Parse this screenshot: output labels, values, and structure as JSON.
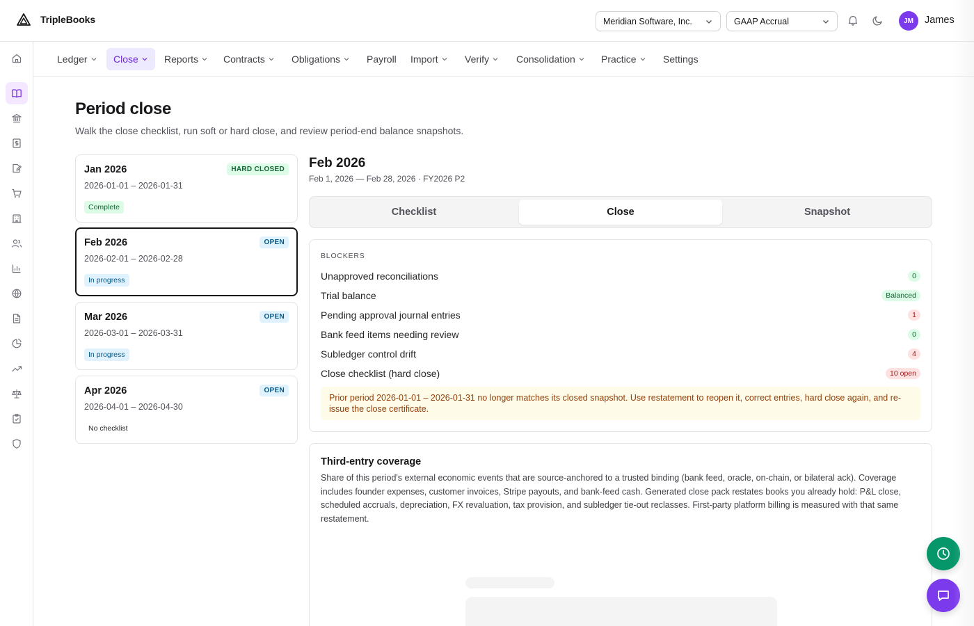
{
  "app": {
    "name": "TripleBooks"
  },
  "header": {
    "entity_select": "Meridian Software, Inc.",
    "basis_select": "GAAP Accrual",
    "user": {
      "initials": "JM",
      "name": "James"
    }
  },
  "sidebar": {
    "items": [
      {
        "icon": "home-icon"
      },
      {
        "icon": "book-open-icon",
        "active": true
      },
      {
        "icon": "bank-icon"
      },
      {
        "icon": "dollar-receipt-icon"
      },
      {
        "icon": "file-edit-icon"
      },
      {
        "icon": "cart-icon"
      },
      {
        "icon": "building-icon"
      },
      {
        "icon": "users-icon"
      },
      {
        "icon": "bar-chart-icon"
      },
      {
        "icon": "globe-icon"
      },
      {
        "icon": "document-icon"
      },
      {
        "icon": "pie-chart-icon"
      },
      {
        "icon": "trending-up-icon"
      },
      {
        "icon": "scale-icon"
      },
      {
        "icon": "clipboard-check-icon"
      },
      {
        "icon": "shield-icon"
      }
    ]
  },
  "nav": {
    "items": [
      {
        "label": "Ledger",
        "dropdown": true
      },
      {
        "label": "Close",
        "dropdown": true,
        "active": true
      },
      {
        "label": "Reports",
        "dropdown": true
      },
      {
        "label": "Contracts",
        "dropdown": true
      },
      {
        "label": "Obligations",
        "dropdown": true
      },
      {
        "label": "Payroll",
        "dropdown": false
      },
      {
        "label": "Import",
        "dropdown": true
      },
      {
        "label": "Verify",
        "dropdown": true
      },
      {
        "label": "Consolidation",
        "dropdown": true
      },
      {
        "label": "Practice",
        "dropdown": true
      },
      {
        "label": "Settings",
        "dropdown": false
      }
    ]
  },
  "page": {
    "title": "Period close",
    "subtitle": "Walk the close checklist, run soft or hard close, and review period-end balance snapshots."
  },
  "periods": [
    {
      "name": "Jan 2026",
      "dates": "2026-01-01 – 2026-01-31",
      "status": "HARD CLOSED",
      "progress": "Complete"
    },
    {
      "name": "Feb 2026",
      "dates": "2026-02-01 – 2026-02-28",
      "status": "OPEN",
      "progress": "In progress"
    },
    {
      "name": "Mar 2026",
      "dates": "2026-03-01 – 2026-03-31",
      "status": "OPEN",
      "progress": "In progress"
    },
    {
      "name": "Apr 2026",
      "dates": "2026-04-01 – 2026-04-30",
      "status": "OPEN",
      "progress": "No checklist"
    }
  ],
  "detail": {
    "title": "Feb 2026",
    "subtitle": "Feb 1, 2026 — Feb 28, 2026 · FY2026 P2",
    "tabs": [
      "Checklist",
      "Close",
      "Snapshot"
    ],
    "active_tab": "Close"
  },
  "blockers": {
    "heading": "BLOCKERS",
    "rows": [
      {
        "label": "Unapproved reconciliations",
        "value": "0",
        "tone": "green"
      },
      {
        "label": "Trial balance",
        "value": "Balanced",
        "tone": "green"
      },
      {
        "label": "Pending approval journal entries",
        "value": "1",
        "tone": "red"
      },
      {
        "label": "Bank feed items needing review",
        "value": "0",
        "tone": "green"
      },
      {
        "label": "Subledger control drift",
        "value": "4",
        "tone": "red"
      },
      {
        "label": "Close checklist (hard close)",
        "value": "10 open",
        "tone": "red"
      }
    ],
    "warning": "Prior period 2026-01-01 – 2026-01-31 no longer matches its closed snapshot. Use restatement to reopen it, correct entries, hard close again, and re-issue the close certificate."
  },
  "coverage": {
    "title": "Third-entry coverage",
    "description": "Share of this period's external economic events that are source-anchored to a trusted binding (bank feed, oracle, on-chain, or bilateral ack). Coverage includes founder expenses, customer invoices, Stripe payouts, and bank-feed cash. Generated close pack restates books you already hold: P&L close, scheduled accruals, depreciation, FX revaluation, tax provision, and subledger tie-out reclasses. First-party platform billing is measured with that same restatement."
  },
  "colors": {
    "accent": "#7c3aed",
    "success": "#059669",
    "danger": "#991b1b"
  }
}
